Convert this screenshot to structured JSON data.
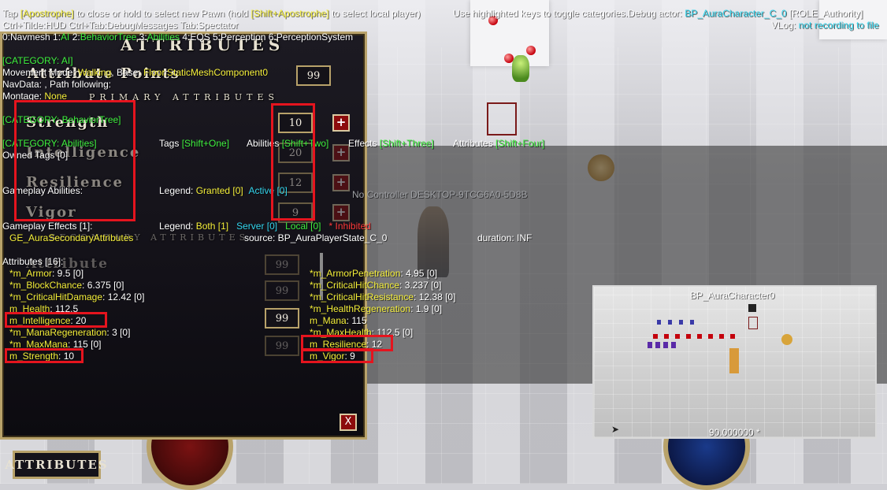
{
  "debug_header": {
    "line1_tap": "Tap ",
    "line1_key1": "[Apostrophe]",
    "line1_mid": " to close or hold to select new Pawn (hold ",
    "line1_key2": "[Shift+Apostrophe]",
    "line1_end": " to select local player)",
    "line1_tail": "Use highlighted keys to toggle categories.",
    "debug_actor_label": "Debug actor: ",
    "debug_actor_value": "BP_AuraCharacter_C_0",
    "debug_actor_role": " [ROLE_Authority]",
    "vlog_label": "VLog: ",
    "vlog_value": "not recording to file",
    "line2": "Ctrl+Tilde:HUD  Ctrl+Tab:DebugMessages  Tab:Spectator",
    "categories_prefix": "0:Navmesh  1:",
    "cat_ai": "AI",
    "cat_2": "  2:",
    "cat_bt": "BehaviorTree",
    "cat_3": "  3:",
    "cat_abilities": "Abilities",
    "categories_rest": "  4:EQS  5:Perception  6:PerceptionSystem"
  },
  "ai_section": {
    "title": "[CATEGORY: AI]",
    "movement_label": "Movement Mode: ",
    "movement_value": "Walking",
    "base_label": ", Base: ",
    "base_value": "Floor.StaticMeshComponent0",
    "navdata": "NavData: , Path following:",
    "montage_label": "Montage: ",
    "montage_value": "None"
  },
  "bt_section": {
    "title": "[CATEGORY: BehaviorTree]"
  },
  "abilities_section": {
    "title": "[CATEGORY: Abilities]",
    "tags_label": "Tags ",
    "tags_key": "[Shift+One]",
    "abilities_label": "Abilities ",
    "abilities_key": "[Shift+Two]",
    "effects_label": "Effects ",
    "effects_key": "[Shift+Three]",
    "attributes_label": "Attributes ",
    "attributes_key": "[Shift+Four]",
    "owned_tags": "Owned Tags [0]",
    "gameplay_abilities": "Gameplay Abilities:",
    "legend1_label": "Legend:  ",
    "legend1_granted": "Granted [0]",
    "legend1_active": "Active [0]",
    "no_controller": "No Controller DESKTOP-9TCG6A0-5D8B",
    "gameplay_effects": "Gameplay Effects [1]:",
    "legend2_label": "Legend:  ",
    "legend2_both": "Both [1]",
    "legend2_server": "Server [0]",
    "legend2_local": "Local [0]",
    "legend2_inhibited": "* Inhibited",
    "effect_name": "GE_AuraSecondaryAttributes",
    "effect_source": "source: BP_AuraPlayerState_C_0",
    "effect_duration": "duration: INF",
    "attributes_count": "Attributes [16]:"
  },
  "attributes_left": [
    {
      "name": "*m_Armor",
      "value": ": 9.5 [0]"
    },
    {
      "name": "*m_BlockChance",
      "value": ": 6.375 [0]"
    },
    {
      "name": "*m_CriticalHitDamage",
      "value": ": 12.42 [0]"
    },
    {
      "name": "m_Health",
      "value": ": 112.5"
    },
    {
      "name": "m_Intelligence",
      "value": ": 20"
    },
    {
      "name": "*m_ManaRegeneration",
      "value": ": 3 [0]"
    },
    {
      "name": "*m_MaxMana",
      "value": ": 115 [0]"
    },
    {
      "name": "m_Strength",
      "value": ": 10"
    }
  ],
  "attributes_right": [
    {
      "name": "*m_ArmorPenetration",
      "value": ": 4.95 [0]"
    },
    {
      "name": "*m_CriticalHitChance",
      "value": ": 3.237 [0]"
    },
    {
      "name": "*m_CriticalHitResistance",
      "value": ": 12.38 [0]"
    },
    {
      "name": "*m_HealthRegeneration",
      "value": ": 1.9 [0]"
    },
    {
      "name": "m_Mana",
      "value": ": 115"
    },
    {
      "name": "*m_MaxHealth",
      "value": ": 112.5 [0]"
    },
    {
      "name": "m_Resilience",
      "value": ": 12"
    },
    {
      "name": "m_Vigor",
      "value": ": 9"
    }
  ],
  "attribute_menu": {
    "title": "ATTRIBUTES",
    "attribute_points_label": "Attribute Points",
    "attribute_points_value": "99",
    "primary_header": "PRIMARY ATTRIBUTES",
    "primary": [
      {
        "label": "Strength",
        "value": "10"
      },
      {
        "label": "Intelligence",
        "value": "20"
      },
      {
        "label": "Resilience",
        "value": "12"
      },
      {
        "label": "Vigor",
        "value": "9"
      }
    ],
    "plus_label": "+",
    "secondary_header": "SECONDARY ATTRIBUTES",
    "secondary_row_label": "Attribute",
    "secondary_values": [
      "99",
      "99",
      "99",
      "99"
    ],
    "close_label": "X",
    "bottom_button": "ATTRIBUTES"
  },
  "minimap": {
    "title": "BP_AuraCharacter0",
    "footer": "90.000000 *"
  }
}
